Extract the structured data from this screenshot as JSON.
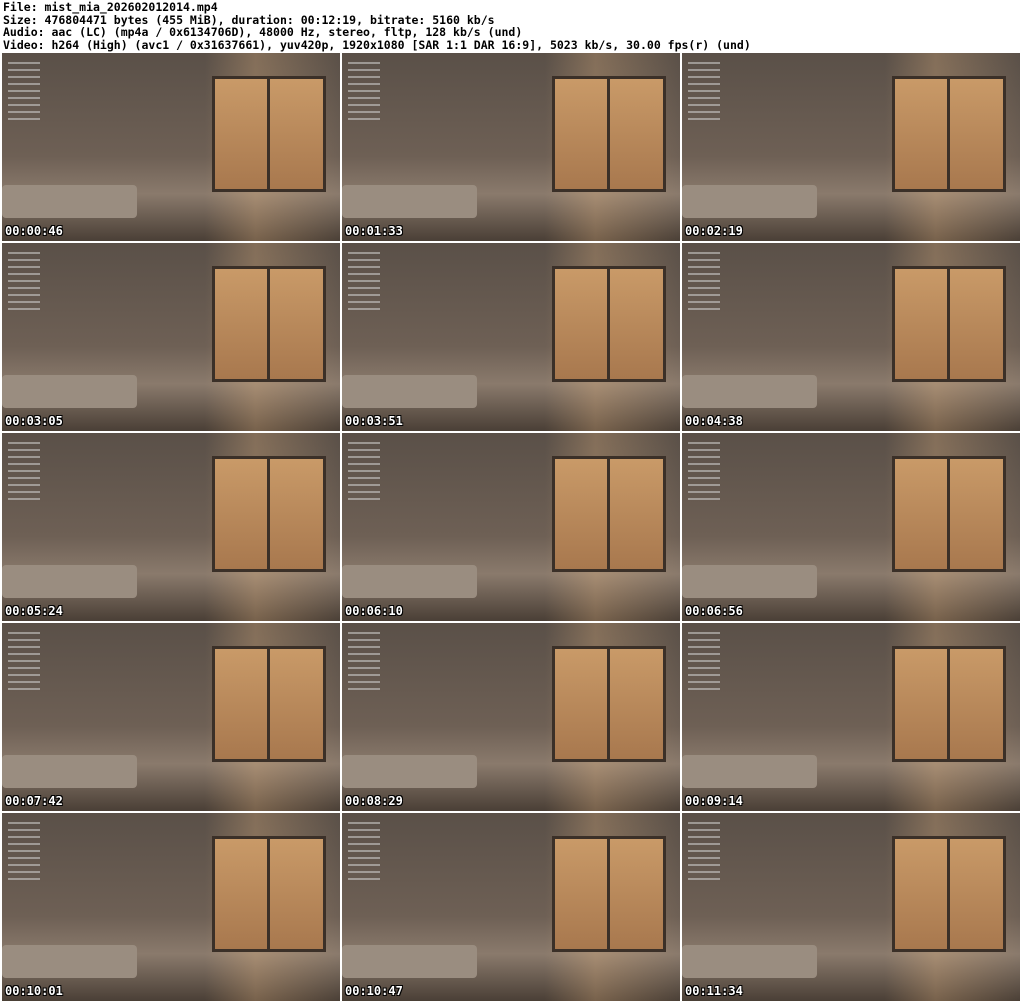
{
  "header": {
    "file": "File: mist_mia_202602012014.mp4",
    "size": "Size: 476804471 bytes (455 MiB), duration: 00:12:19, bitrate: 5160 kb/s",
    "audio": "Audio: aac (LC) (mp4a / 0x6134706D), 48000 Hz, stereo, fltp, 128 kb/s (und)",
    "video": "Video: h264 (High) (avc1 / 0x31637661), yuv420p, 1920x1080 [SAR 1:1 DAR 16:9], 5023 kb/s, 30.00 fps(r) (und)"
  },
  "thumbnails": [
    {
      "timestamp": "00:00:46"
    },
    {
      "timestamp": "00:01:33"
    },
    {
      "timestamp": "00:02:19"
    },
    {
      "timestamp": "00:03:05"
    },
    {
      "timestamp": "00:03:51"
    },
    {
      "timestamp": "00:04:38"
    },
    {
      "timestamp": "00:05:24"
    },
    {
      "timestamp": "00:06:10"
    },
    {
      "timestamp": "00:06:56"
    },
    {
      "timestamp": "00:07:42"
    },
    {
      "timestamp": "00:08:29"
    },
    {
      "timestamp": "00:09:14"
    },
    {
      "timestamp": "00:10:01"
    },
    {
      "timestamp": "00:10:47"
    },
    {
      "timestamp": "00:11:34"
    }
  ]
}
